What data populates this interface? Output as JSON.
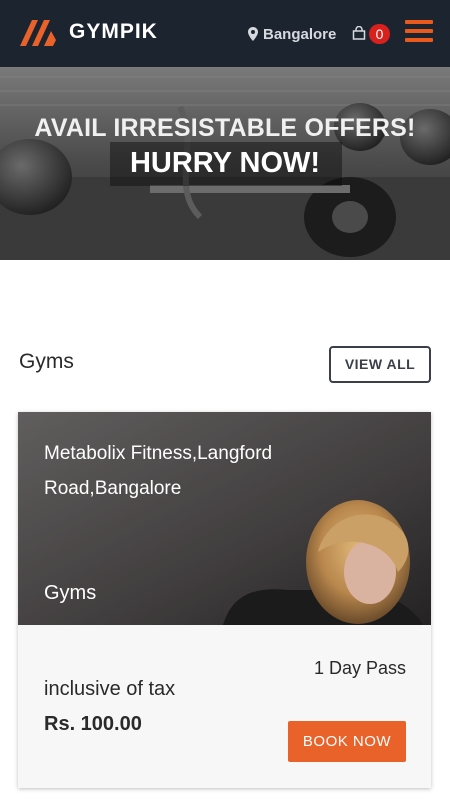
{
  "header": {
    "brand": "GYMPIK",
    "location": "Bangalore",
    "cart_count": "0",
    "accent_color": "#ea5a1c",
    "background_color": "#1c2430",
    "icons": [
      "logo-icon",
      "map-pin-icon",
      "shopping-bag-icon",
      "hamburger-menu-icon"
    ]
  },
  "banner": {
    "line1": "AVAIL IRRESISTABLE OFFERS!",
    "line2": "HURRY NOW!"
  },
  "section": {
    "title": "Gyms",
    "view_all_label": "VIEW ALL"
  },
  "card": {
    "name": "Metabolix Fitness,Langford Road,Bangalore",
    "category": "Gyms",
    "pass": "1 Day Pass",
    "tax_note": "inclusive of tax",
    "price": "Rs. 100.00",
    "book_label": "BOOK NOW",
    "button_color": "#e8622a"
  }
}
